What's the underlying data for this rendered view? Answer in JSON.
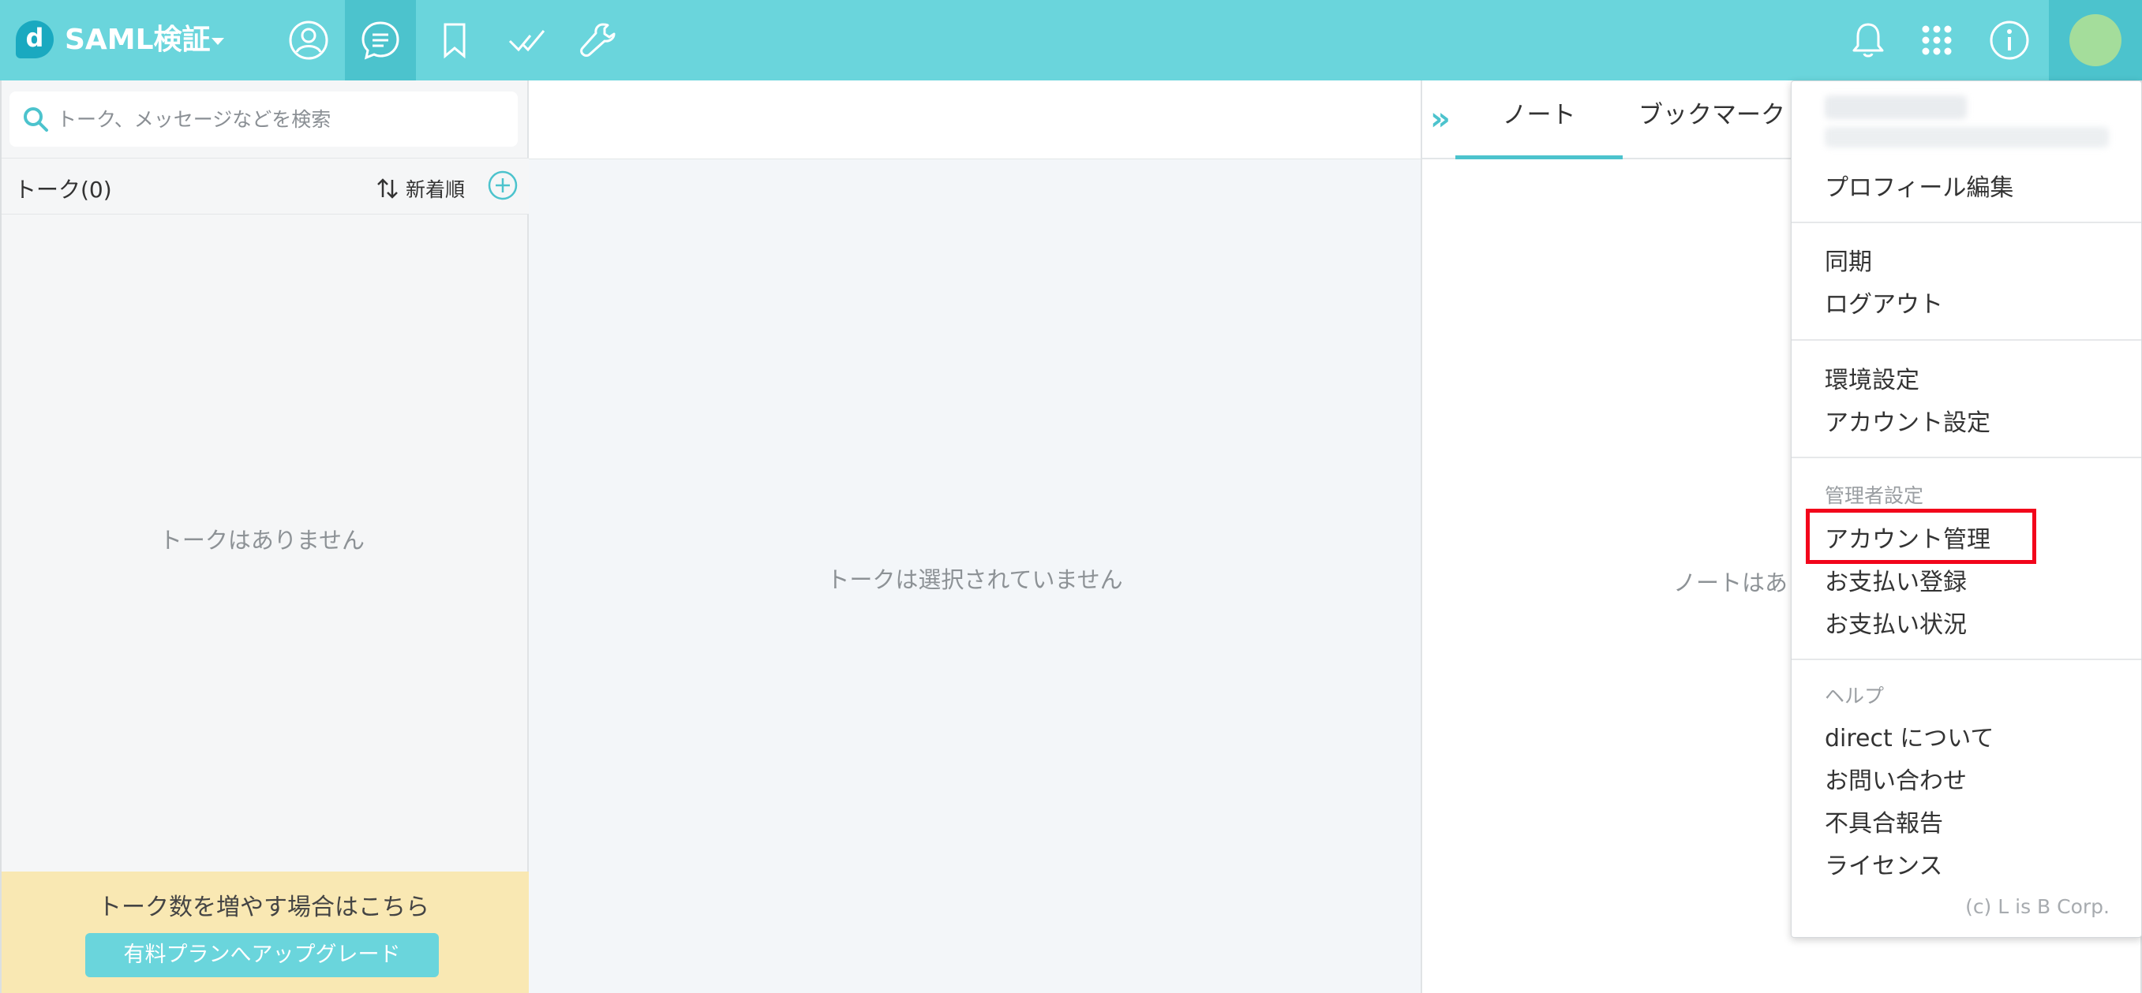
{
  "header": {
    "logo_letter": "d",
    "domain_name": "SAML検証",
    "nav_icons": [
      "user-icon",
      "talk-icon",
      "bookmark-icon",
      "check-icon",
      "wrench-icon"
    ],
    "right_icons": [
      "bell-icon",
      "apps-grid-icon",
      "info-icon",
      "avatar"
    ],
    "accent_color": "#6ad5dc"
  },
  "sidebar": {
    "search_placeholder": "トーク、メッセージなどを検索",
    "talk_count_label": "トーク(0)",
    "sort_label": "新着順",
    "empty_text": "トークはありません",
    "upgrade_text": "トーク数を増やす場合はこちら",
    "upgrade_button": "有料プランへアップグレード"
  },
  "center": {
    "empty_text": "トークは選択されていません"
  },
  "right_panel": {
    "tabs": [
      "ノート",
      "ブックマーク"
    ],
    "active_tab": "ノート",
    "empty_text": "ノートはあ"
  },
  "menu": {
    "profile_edit": "プロフィール編集",
    "sync": "同期",
    "logout": "ログアウト",
    "preferences": "環境設定",
    "account_settings": "アカウント設定",
    "admin_header": "管理者設定",
    "account_management": "アカウント管理",
    "payment_register": "お支払い登録",
    "payment_status": "お支払い状況",
    "help_header": "ヘルプ",
    "about": "direct について",
    "contact": "お問い合わせ",
    "bug_report": "不具合報告",
    "license": "ライセンス",
    "copyright": "(c) L is B Corp.",
    "highlight_color": "#f2051b"
  }
}
